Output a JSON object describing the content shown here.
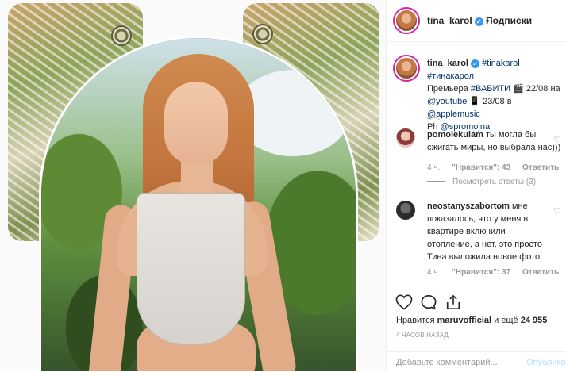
{
  "header": {
    "username": "tina_karol",
    "verified_mark": "✓",
    "dot": "•",
    "follow_label": "Подписки"
  },
  "caption": {
    "username": "tina_karol",
    "parts": {
      "tag1": "#tinakarol",
      "tag2": "#тинакарол",
      "premiere": "Премьера",
      "tag3": "#ВАБИТИ",
      "clapper": "🎬",
      "date1": "22/08 на",
      "youtube": "@youtube",
      "phone": "📱",
      "date2": "23/08 в",
      "apple": "@applemusic",
      "ph": "Ph",
      "photographer": "@spromojna"
    },
    "time": "4 ч."
  },
  "comments": [
    {
      "username": "pomolekulam",
      "text": "ты могла бы сжигать миры, но выбрала нас)))",
      "time": "4 ч.",
      "likes": "\"Нравится\": 43",
      "reply": "Ответить",
      "view_replies": "Посмотреть ответы (3)"
    },
    {
      "username": "neostanyszabortom",
      "text": "мне показалось, что у меня в квартире включили отопление, а нет, это просто Тина выложила новое фото",
      "time": "4 ч.",
      "likes": "\"Нравится\": 37",
      "reply": "Ответить"
    }
  ],
  "actions": {
    "icons": [
      "heart-icon",
      "comment-icon",
      "share-icon"
    ]
  },
  "likes": {
    "prefix": "Нравится",
    "user": "maruvofficial",
    "and": "и ещё",
    "count": "24 955"
  },
  "timestamp": "4 ЧАСОВ НАЗАД",
  "add_comment": {
    "placeholder": "Добавьте комментарий...",
    "post_label": "Опубликов"
  },
  "colors": {
    "link": "#003569",
    "verified": "#3897f0",
    "muted": "#999999",
    "post_button": "#b2dffc"
  }
}
